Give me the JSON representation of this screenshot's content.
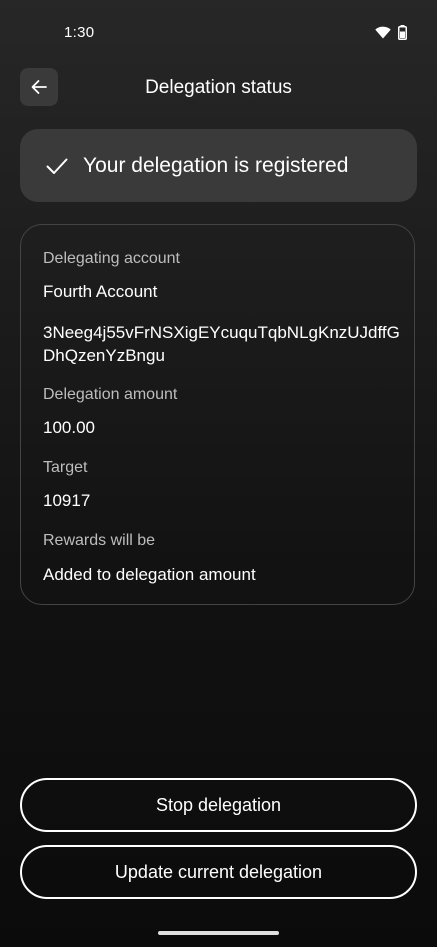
{
  "status_bar": {
    "time": "1:30",
    "icons": [
      "wifi-icon",
      "battery-icon"
    ]
  },
  "header": {
    "title": "Delegation status",
    "back_icon": "arrow-left-icon"
  },
  "banner": {
    "icon": "checkmark-icon",
    "text": "Your delegation is registered"
  },
  "details": {
    "account_label": "Delegating account",
    "account_name": "Fourth Account",
    "account_address": "3Neeg4j55vFrNSXigEYcuquTqbNLgKnzUJdffGDhQzenYzBngu",
    "amount_label": "Delegation amount",
    "amount_value": "100.00",
    "target_label": "Target",
    "target_value": "10917",
    "rewards_label": "Rewards will be",
    "rewards_value": "Added to delegation amount"
  },
  "actions": {
    "stop_label": "Stop delegation",
    "update_label": "Update current delegation"
  },
  "colors": {
    "background": "#1a1a1a",
    "surface": "#3a3a3a",
    "border": "#444444",
    "text": "#ffffff",
    "muted": "#bdbdbd"
  }
}
